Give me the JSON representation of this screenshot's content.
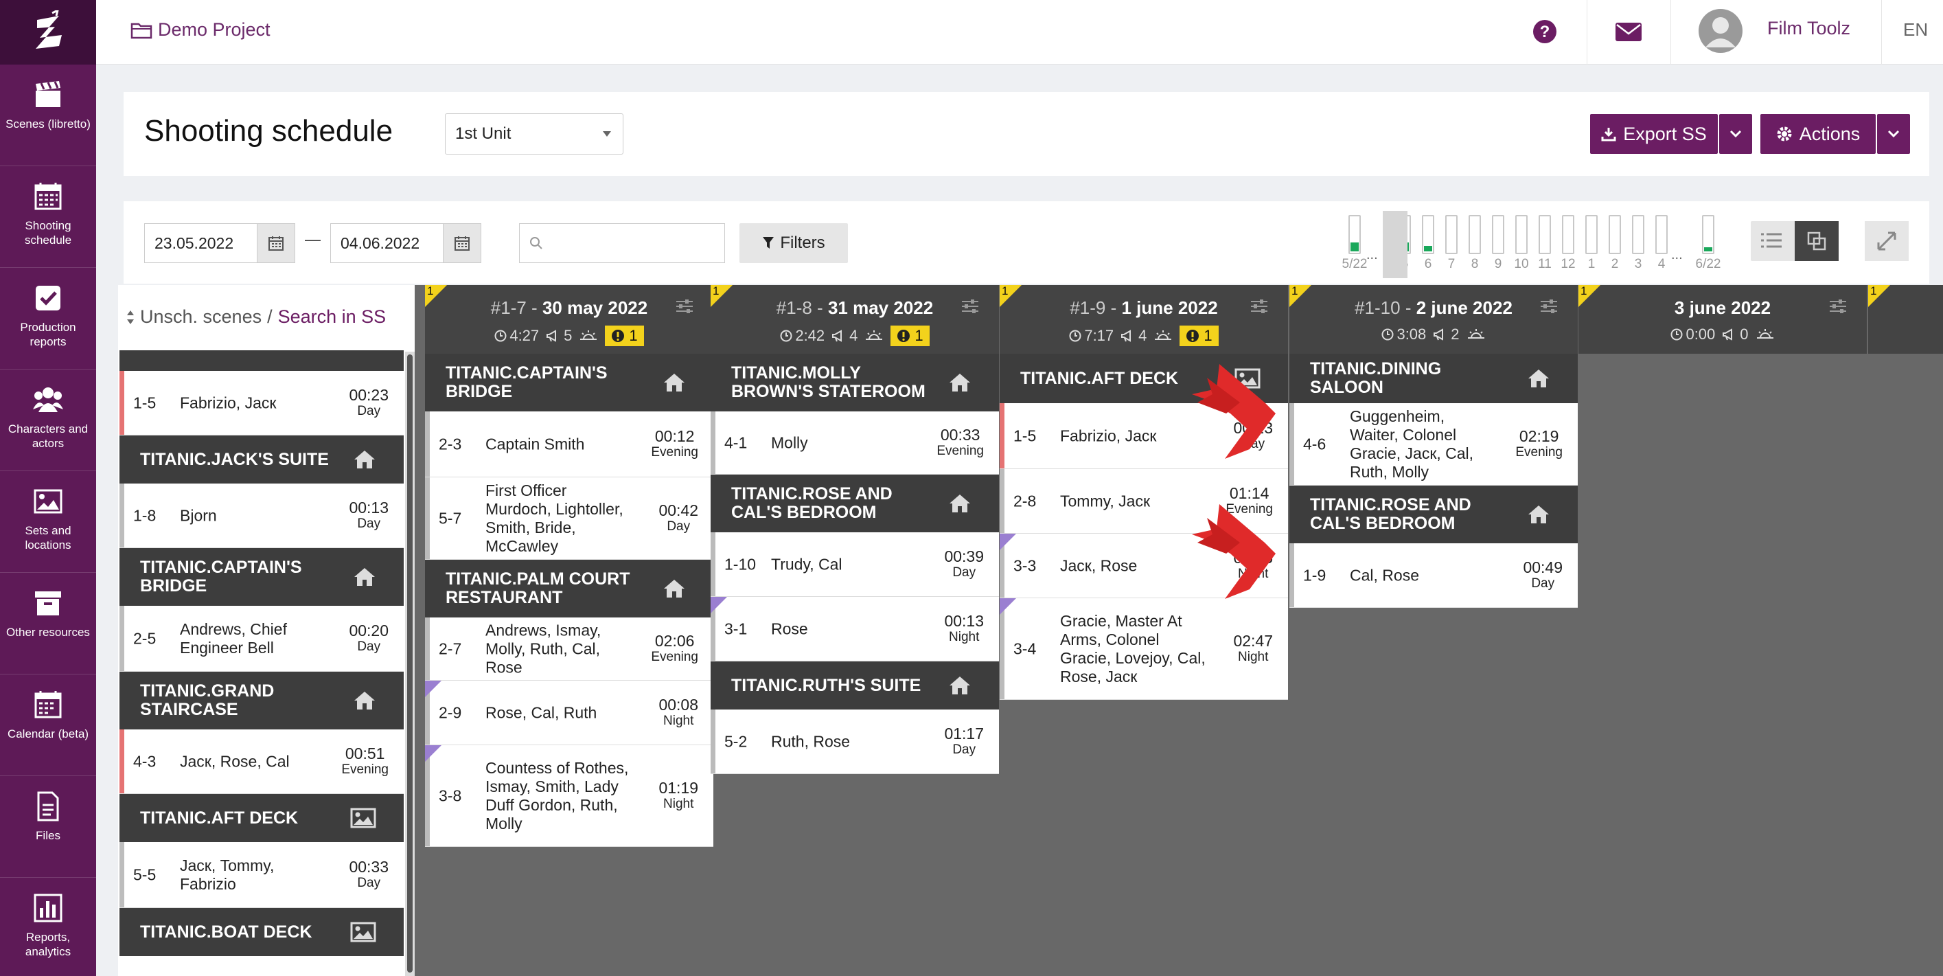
{
  "nav": [
    {
      "label": "Scenes (libretto)",
      "icon": "clapperboard-icon"
    },
    {
      "label": "Shooting schedule",
      "icon": "calendar-grid-icon"
    },
    {
      "label": "Production reports",
      "icon": "checkbox-icon"
    },
    {
      "label": "Characters and actors",
      "icon": "users-icon"
    },
    {
      "label": "Sets and locations",
      "icon": "image-icon"
    },
    {
      "label": "Other resources",
      "icon": "archive-icon"
    },
    {
      "label": "Calendar (beta)",
      "icon": "calendar-icon"
    },
    {
      "label": "Files",
      "icon": "file-icon"
    },
    {
      "label": "Reports, analytics",
      "icon": "bar-chart-icon"
    }
  ],
  "topbar": {
    "project": "Demo Project",
    "user": "Film Toolz",
    "lang": "EN"
  },
  "page": {
    "title": "Shooting schedule",
    "unit": "1st Unit",
    "export": "Export SS",
    "actions": "Actions"
  },
  "filters": {
    "date_from": "23.05.2022",
    "date_to": "04.06.2022",
    "label": "Filters",
    "dash": "—"
  },
  "days_strip": {
    "first": "5/22",
    "last": "6/22",
    "dots": "...",
    "nums": [
      "5",
      "6",
      "7",
      "8",
      "9",
      "10",
      "11",
      "12",
      "1",
      "2",
      "3",
      "4"
    ]
  },
  "left": {
    "unsch": "Unsch. scenes",
    "sep": "/",
    "search": "Search in SS"
  },
  "badge_num": "1",
  "unscheduled": [
    {
      "type": "scene",
      "num": "1-5",
      "chars": "Fabrizio, Jacк",
      "time": "00:23",
      "dn": "Day",
      "stripe": "#e57373"
    },
    {
      "type": "set",
      "name": "TITANIC.JACK'S SUITE",
      "icon": "home"
    },
    {
      "type": "scene",
      "num": "1-8",
      "chars": "Bjorn",
      "time": "00:13",
      "dn": "Day",
      "stripe": "#bdbdbd"
    },
    {
      "type": "set",
      "name": "TITANIC.CAPTAIN'S BRIDGE",
      "icon": "home"
    },
    {
      "type": "scene",
      "num": "2-5",
      "chars": "Andrews, Chief Engineer Bell",
      "time": "00:20",
      "dn": "Day",
      "stripe": "#bdbdbd"
    },
    {
      "type": "set",
      "name": "TITANIC.GRAND STAIRCASE",
      "icon": "home"
    },
    {
      "type": "scene",
      "num": "4-3",
      "chars": "Jacк, Rose, Cal",
      "time": "00:51",
      "dn": "Evening",
      "stripe": "#e57373"
    },
    {
      "type": "set",
      "name": "TITANIC.AFT DECK",
      "icon": "image"
    },
    {
      "type": "scene",
      "num": "5-5",
      "chars": "Jacк, Tommy, Fabrizio",
      "time": "00:33",
      "dn": "Day",
      "stripe": "#bdbdbd"
    },
    {
      "type": "set",
      "name": "TITANIC.BOAT DECK",
      "icon": "image"
    }
  ],
  "days": [
    {
      "pre": "#1-7 - ",
      "date": "30 may 2022",
      "time": "4:27",
      "scenes": "5",
      "warn": "1",
      "items": [
        {
          "type": "set",
          "name": "TITANIC.CAPTAIN'S BRIDGE",
          "icon": "home",
          "h": 84
        },
        {
          "type": "scene",
          "num": "2-3",
          "chars": "Captain Smith",
          "time": "00:12",
          "dn": "Evening",
          "h": 96
        },
        {
          "type": "scene",
          "num": "5-7",
          "chars": "First Officer Murdoch, Lightoller, Smith, Bride, McCawley",
          "time": "00:42",
          "dn": "Day",
          "h": 120
        },
        {
          "type": "set",
          "name": "TITANIC.PALM COURT RESTAURANT",
          "icon": "home",
          "h": 84
        },
        {
          "type": "scene",
          "num": "2-7",
          "chars": "Andrews, Ismay, Molly, Ruth, Cal, Rose",
          "time": "02:06",
          "dn": "Evening",
          "h": 92
        },
        {
          "type": "scene",
          "num": "2-9",
          "chars": "Rose, Cal, Ruth",
          "time": "00:08",
          "dn": "Night",
          "h": 94,
          "tri": true
        },
        {
          "type": "scene",
          "num": "3-8",
          "chars": "Countess of Rothes, Ismay, Smith, Lady Duff Gordon, Ruth, Molly",
          "time": "01:19",
          "dn": "Night",
          "h": 148,
          "tri": true
        }
      ]
    },
    {
      "pre": "#1-8 - ",
      "date": "31 may 2022",
      "time": "2:42",
      "scenes": "4",
      "warn": "1",
      "items": [
        {
          "type": "set",
          "name": "TITANIC.MOLLY BROWN'S STATEROOM",
          "icon": "home",
          "h": 84
        },
        {
          "type": "scene",
          "num": "4-1",
          "chars": "Molly",
          "time": "00:33",
          "dn": "Evening",
          "h": 92
        },
        {
          "type": "set",
          "name": "TITANIC.ROSE AND CAL'S BEDROOM",
          "icon": "home",
          "h": 84
        },
        {
          "type": "scene",
          "num": "1-10",
          "chars": "Trudy, Cal",
          "time": "00:39",
          "dn": "Day",
          "h": 94
        },
        {
          "type": "scene",
          "num": "3-1",
          "chars": "Rose",
          "time": "00:13",
          "dn": "Night",
          "h": 94,
          "tri": true
        },
        {
          "type": "set",
          "name": "TITANIC.RUTH'S SUITE",
          "icon": "home",
          "h": 70
        },
        {
          "type": "scene",
          "num": "5-2",
          "chars": "Ruth, Rose",
          "time": "01:17",
          "dn": "Day",
          "h": 94
        }
      ]
    },
    {
      "pre": "#1-9 - ",
      "date": "1 june 2022",
      "time": "7:17",
      "scenes": "4",
      "warn": "1",
      "items": [
        {
          "type": "set",
          "name": "TITANIC.AFT DECK",
          "icon": "image",
          "h": 72
        },
        {
          "type": "scene",
          "num": "1-5",
          "chars": "Fabrizio, Jacк",
          "time": "00:23",
          "dn": "Day",
          "h": 96,
          "stripe": "#e57373"
        },
        {
          "type": "scene",
          "num": "2-8",
          "chars": "Tommy, Jacк",
          "time": "01:14",
          "dn": "Evening",
          "h": 94
        },
        {
          "type": "scene",
          "num": "3-3",
          "chars": "Jacк, Rose",
          "time": "00:15",
          "dn": "Night",
          "h": 94,
          "tri": true
        },
        {
          "type": "scene",
          "num": "3-4",
          "chars": "Gracie, Master At Arms, Colonel Gracie, Lovejoy, Cal, Rose, Jacк",
          "time": "02:47",
          "dn": "Night",
          "h": 148,
          "tri": true
        }
      ]
    },
    {
      "pre": "#1-10 - ",
      "date": "2 june 2022",
      "time": "3:08",
      "scenes": "2",
      "warn": "",
      "items": [
        {
          "type": "set",
          "name": "TITANIC.DINING SALOON",
          "icon": "home",
          "h": 72
        },
        {
          "type": "scene",
          "num": "4-6",
          "chars": "Guggenheim, Waiter, Colonel Gracie, Jacк, Cal, Ruth, Molly",
          "time": "02:19",
          "dn": "Evening",
          "h": 120
        },
        {
          "type": "set",
          "name": "TITANIC.ROSE AND CAL'S BEDROOM",
          "icon": "home",
          "h": 84
        },
        {
          "type": "scene",
          "num": "1-9",
          "chars": "Cal, Rose",
          "time": "00:49",
          "dn": "Day",
          "h": 94
        }
      ]
    },
    {
      "pre": "",
      "date": "3 june 2022",
      "time": "0:00",
      "scenes": "0",
      "warn": "",
      "items": []
    }
  ],
  "colors": {
    "brand": "#5e1a57",
    "button": "#6b1d63",
    "badge": "#f3d21c",
    "set": "#3d3d3d",
    "board": "#686868"
  }
}
